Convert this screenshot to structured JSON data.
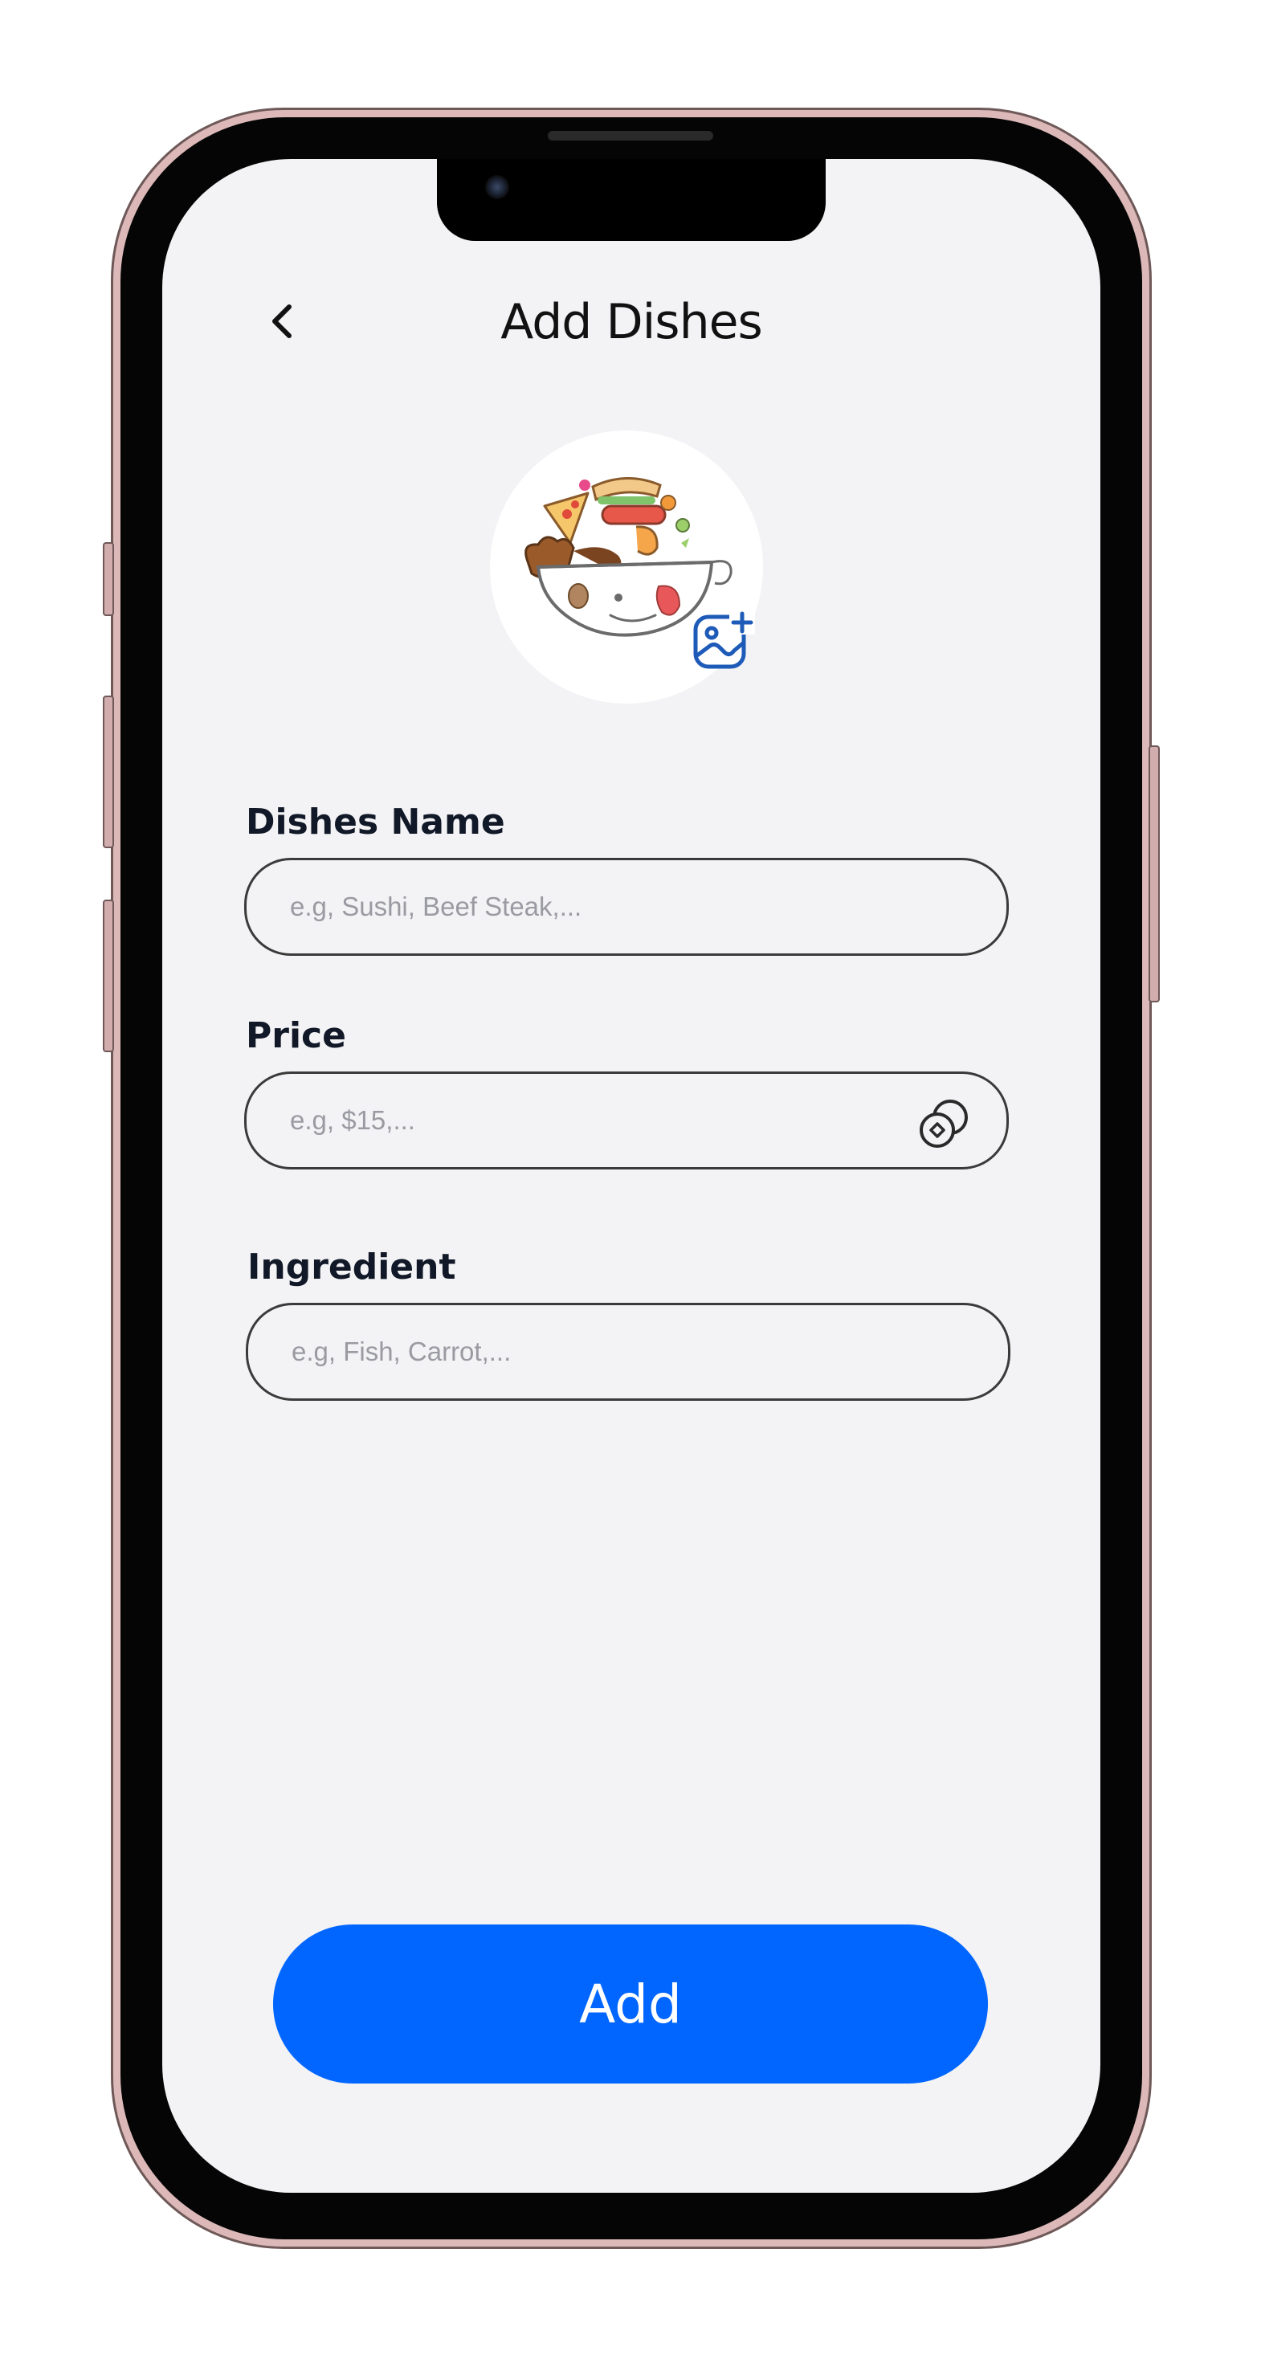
{
  "header": {
    "title": "Add Dishes",
    "back_icon": "chevron-left-icon"
  },
  "avatar": {
    "image": "food-bowl-illustration",
    "upload_icon": "add-photo-icon",
    "accent_color": "#1e5bb8"
  },
  "form": {
    "dish_name": {
      "label": "Dishes Name",
      "placeholder": "e.g, Sushi, Beef Steak,...",
      "value": ""
    },
    "price": {
      "label": "Price",
      "placeholder": "e.g, $15,...",
      "value": "",
      "icon": "coins-icon"
    },
    "ingredient": {
      "label": "Ingredient",
      "placeholder": "e.g, Fish, Carrot,...",
      "value": ""
    }
  },
  "actions": {
    "add_label": "Add",
    "add_color": "#0066ff"
  },
  "device": {
    "frame_color": "#dcb8b8",
    "screen_background": "#f3f3f5"
  }
}
